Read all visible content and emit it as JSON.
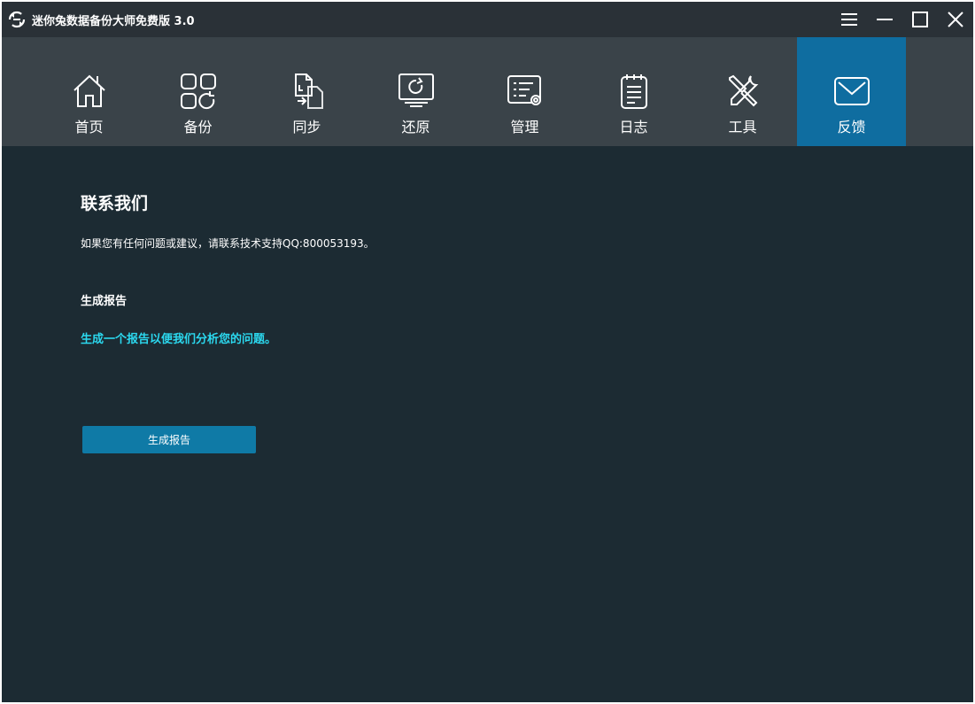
{
  "window": {
    "title": "迷你兔数据备份大师免费版 3.0"
  },
  "titlebar_buttons": {
    "menu": "menu-icon",
    "minimize": "minimize-icon",
    "maximize": "maximize-icon",
    "close": "close-icon"
  },
  "nav": {
    "items": [
      {
        "label": "首页",
        "icon": "home-icon"
      },
      {
        "label": "备份",
        "icon": "backup-icon"
      },
      {
        "label": "同步",
        "icon": "sync-icon"
      },
      {
        "label": "还原",
        "icon": "restore-icon"
      },
      {
        "label": "管理",
        "icon": "manage-icon"
      },
      {
        "label": "日志",
        "icon": "log-icon"
      },
      {
        "label": "工具",
        "icon": "tools-icon"
      },
      {
        "label": "反馈",
        "icon": "feedback-icon"
      }
    ],
    "active": "反馈"
  },
  "contact": {
    "title": "联系我们",
    "text": "如果您有任何问题或建议，请联系技术支持QQ:800053193。"
  },
  "report": {
    "heading": "生成报告",
    "description": "生成一个报告以便我们分析您的问题。",
    "button_label": "生成报告"
  },
  "colors": {
    "titlebar": "#2a3137",
    "navbar": "#3a4349",
    "active_tab": "#0f6da0",
    "content_bg": "#1c2b33",
    "accent_text": "#2bd8ef",
    "button": "#0f7aa6"
  }
}
